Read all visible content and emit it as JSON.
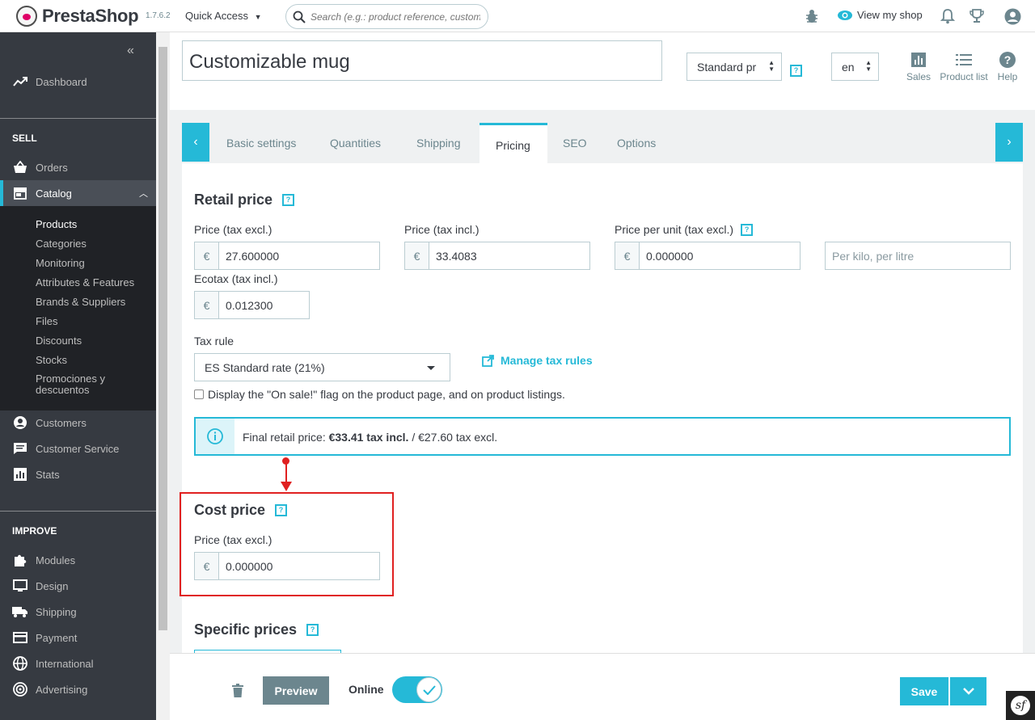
{
  "header": {
    "brand": "PrestaShop",
    "version": "1.7.6.2",
    "quick_access": "Quick Access",
    "search_placeholder": "Search (e.g.: product reference, custome",
    "view_my_shop": "View my shop"
  },
  "sidebar": {
    "dashboard": "Dashboard",
    "sell_heading": "SELL",
    "orders": "Orders",
    "catalog": "Catalog",
    "catalog_sub": [
      "Products",
      "Categories",
      "Monitoring",
      "Attributes & Features",
      "Brands & Suppliers",
      "Files",
      "Discounts",
      "Stocks"
    ],
    "promociones_line1": "Promociones y",
    "promociones_line2": "descuentos",
    "customers": "Customers",
    "customer_service": "Customer Service",
    "stats": "Stats",
    "improve_heading": "IMPROVE",
    "modules": "Modules",
    "design": "Design",
    "shipping": "Shipping",
    "payment": "Payment",
    "international": "International",
    "advertising": "Advertising"
  },
  "product": {
    "name": "Customizable mug",
    "type_select": "Standard pr",
    "lang_select": "en"
  },
  "toolbar": {
    "sales": "Sales",
    "product_list": "Product list",
    "help": "Help"
  },
  "tabs": [
    "Basic settings",
    "Quantities",
    "Shipping",
    "Pricing",
    "SEO",
    "Options"
  ],
  "retail": {
    "heading": "Retail price",
    "price_excl_label": "Price (tax excl.)",
    "price_excl_value": "27.600000",
    "price_incl_label": "Price (tax incl.)",
    "price_incl_value": "33.4083",
    "unit_label": "Price per unit (tax excl.)",
    "unit_value": "0.000000",
    "unit_placeholder": "Per kilo, per litre",
    "ecotax_label": "Ecotax (tax incl.)",
    "ecotax_value": "0.012300",
    "currency": "€",
    "tax_rule_label": "Tax rule",
    "tax_rule_value": "ES Standard rate (21%)",
    "manage_tax_rules": "Manage tax rules",
    "on_sale_label": "Display the \"On sale!\" flag on the product page, and on product listings.",
    "final_prefix": "Final retail price: ",
    "final_incl": "€33.41 tax incl.",
    "final_suffix": " / €27.60 tax excl."
  },
  "cost": {
    "heading": "Cost price",
    "price_label": "Price (tax excl.)",
    "price_value": "0.000000"
  },
  "specific": {
    "heading": "Specific prices"
  },
  "footer": {
    "preview": "Preview",
    "online": "Online",
    "save": "Save"
  },
  "colors": {
    "accent": "#25b9d7",
    "sidebar": "#363a41",
    "annotation": "#e02020"
  }
}
